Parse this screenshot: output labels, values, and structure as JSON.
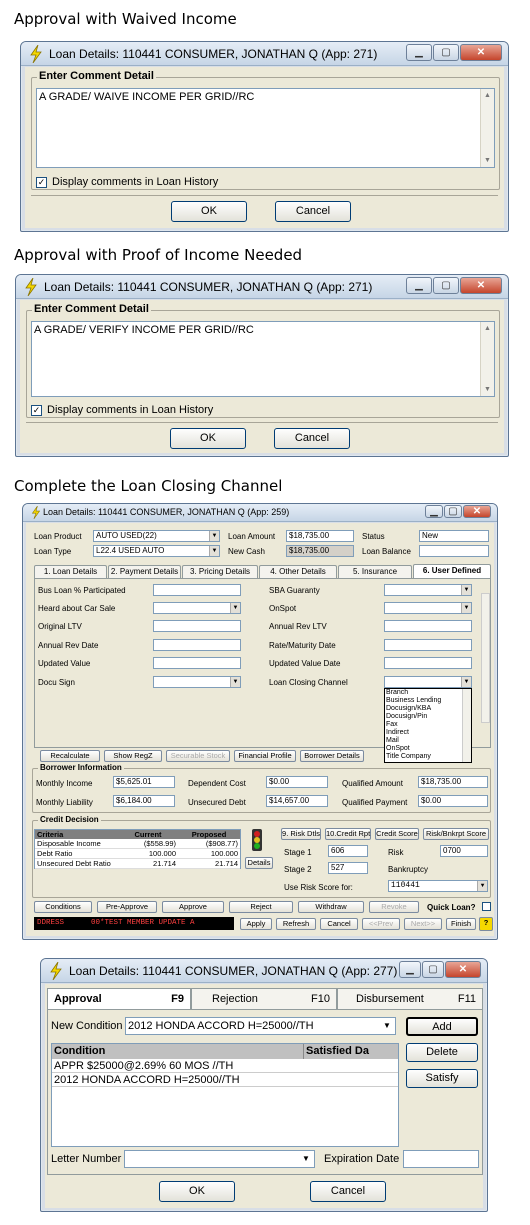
{
  "captions": {
    "c1": "Approval with Waived Income",
    "c2": "Approval with Proof of Income Needed",
    "c3": "Complete the Loan Closing Channel"
  },
  "icons": {
    "app": "lightning-bolt-icon",
    "minimize": "minimize-icon",
    "maximize": "maximize-icon",
    "close": "close-icon"
  },
  "dialog1": {
    "title": "Loan Details: 110441 CONSUMER, JONATHAN Q (App: 271)",
    "group_label": "Enter Comment Detail",
    "comment": "A GRADE/ WAIVE INCOME PER GRID//RC",
    "checkbox_label": "Display comments in Loan History",
    "ok": "OK",
    "cancel": "Cancel"
  },
  "dialog2": {
    "title": "Loan Details: 110441 CONSUMER, JONATHAN Q (App: 271)",
    "group_label": "Enter Comment Detail",
    "comment": "A GRADE/ VERIFY INCOME PER GRID//RC",
    "checkbox_label": "Display comments in Loan History",
    "ok": "OK",
    "cancel": "Cancel"
  },
  "loan": {
    "title": "Loan Details: 110441 CONSUMER, JONATHAN Q (App: 259)",
    "loan_product_label": "Loan Product",
    "loan_product": "AUTO USED(22)",
    "loan_type_label": "Loan Type",
    "loan_type": "L22.4 USED AUTO",
    "loan_amount_label": "Loan Amount",
    "loan_amount": "$18,735.00",
    "new_cash_label": "New Cash",
    "new_cash": "$18,735.00",
    "status_label": "Status",
    "status": "New",
    "loan_balance_label": "Loan Balance",
    "tabs": [
      "1. Loan Details",
      "2. Payment Details",
      "3. Pricing Details",
      "4. Other Details",
      "5. Insurance",
      "6. User Defined"
    ],
    "left_fields": [
      "Bus Loan % Participated",
      "Heard about Car Sale",
      "Original LTV",
      "Annual Rev Date",
      "Updated Value",
      "Docu Sign"
    ],
    "right_fields": [
      "SBA Guaranty",
      "OnSpot",
      "Annual Rev LTV",
      "Rate/Maturity Date",
      "Updated Value Date",
      "Loan Closing Channel"
    ],
    "channel_options": [
      "Branch",
      "Business Lending",
      "Docusign/KBA",
      "Docusign/Pin",
      "Fax",
      "Indirect",
      "Mail",
      "OnSpot",
      "Title Company"
    ],
    "mid_buttons": [
      "Recalculate",
      "Show RegZ",
      "Securable Stock",
      "Financial Profile",
      "Borrower Details"
    ],
    "borrower_label": "Borrower Information",
    "monthly_income_label": "Monthly Income",
    "monthly_income": "$5,625.01",
    "monthly_liability_label": "Monthly Liability",
    "monthly_liability": "$6,184.00",
    "dependent_cost_label": "Dependent Cost",
    "dependent_cost": "$0.00",
    "unsecured_debt_label": "Unsecured Debt",
    "unsecured_debt": "$14,657.00",
    "qualified_amount_label": "Qualified Amount",
    "qualified_amount": "$18,735.00",
    "qualified_payment_label": "Qualified Payment",
    "qualified_payment": "$0.00",
    "credit_label": "Credit Decision",
    "credit_headers": [
      "Criteria",
      "Current",
      "Proposed"
    ],
    "credit_rows": [
      [
        "Disposable Income",
        "($558.99)",
        "($908.77)"
      ],
      [
        "Debt Ratio",
        "100.000",
        "100.000"
      ],
      [
        "Unsecured Debt Ratio",
        "21.714",
        "21.714"
      ]
    ],
    "risk_buttons": [
      "9. Risk Dtls",
      "10.Credit Rpt",
      "Credit Score",
      "Risk/Bnkrpt Score"
    ],
    "details_btn": "Details",
    "stage1_label": "Stage 1",
    "stage1": "606",
    "stage2_label": "Stage 2",
    "stage2": "527",
    "risk_label": "Risk",
    "risk": "0700",
    "bankruptcy_label": "Bankruptcy",
    "use_risk_label": "Use Risk Score for:",
    "use_risk": "110441",
    "action_buttons": [
      "Conditions",
      "Pre-Approve",
      "Approve",
      "Reject",
      "Withdraw",
      "Revoke"
    ],
    "quick_loan": "Quick Loan?",
    "status_bar": "DDRESS      00*TEST MEMBER UPDATE A",
    "bottom_buttons": [
      "Apply",
      "Refresh",
      "Cancel",
      "<<Prev",
      "Next>>",
      "Finish"
    ],
    "help": "?"
  },
  "approval": {
    "title": "Loan Details: 110441 CONSUMER, JONATHAN Q (App: 277)",
    "tabs": [
      {
        "label": "Approval",
        "key": "F9"
      },
      {
        "label": "Rejection",
        "key": "F10"
      },
      {
        "label": "Disbursement",
        "key": "F11"
      }
    ],
    "new_condition_label": "New Condition",
    "new_condition": "2012 HONDA ACCORD H=25000//TH",
    "add": "Add",
    "delete": "Delete",
    "satisfy": "Satisfy",
    "col_condition": "Condition",
    "col_satisfied": "Satisfied Da",
    "rows": [
      "APPR $25000@2.69% 60 MOS //TH",
      "2012 HONDA ACCORD H=25000//TH"
    ],
    "letter_label": "Letter Number",
    "expiration_label": "Expiration Date",
    "ok": "OK",
    "cancel": "Cancel"
  }
}
